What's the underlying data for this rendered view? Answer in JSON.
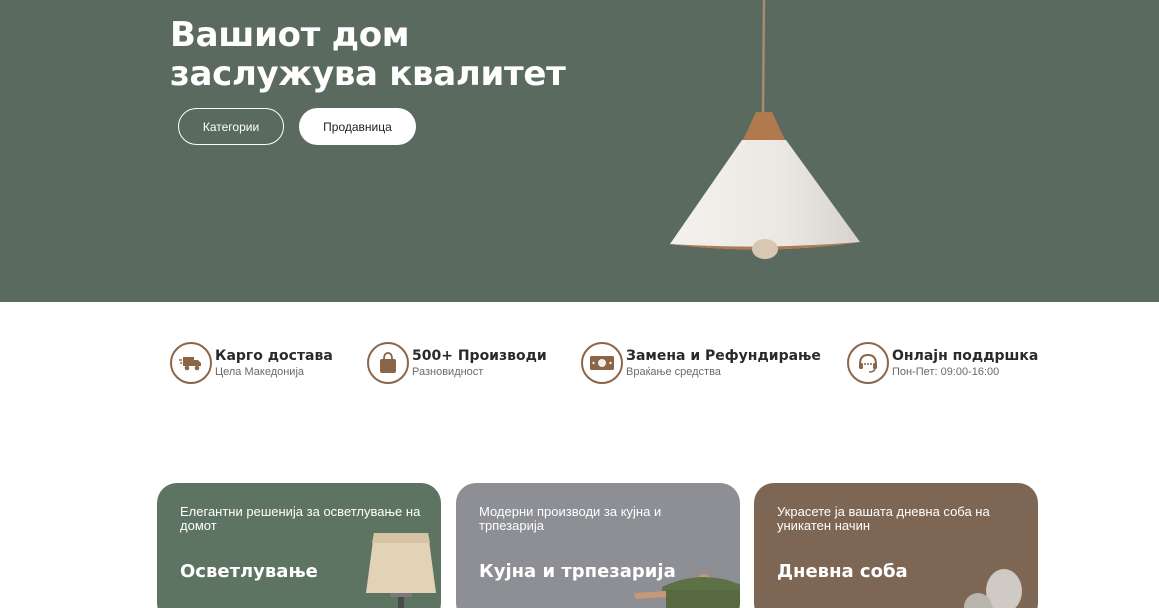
{
  "hero": {
    "title_line1": "Вашиот дом",
    "title_line2": "заслужува квалитет",
    "btn_categories": "Категории",
    "btn_shop": "Продавница"
  },
  "features": [
    {
      "title": "Карго достава",
      "subtitle": "Цела Македонија",
      "icon": "truck-icon"
    },
    {
      "title": "500+ Производи",
      "subtitle": "Разновидност",
      "icon": "shopping-bag-icon"
    },
    {
      "title": "Замена и Рефундирање",
      "subtitle": "Враќање средства",
      "icon": "money-icon"
    },
    {
      "title": "Онлајн поддршка",
      "subtitle": "Пон-Пет: 09:00-16:00",
      "icon": "headset-icon"
    }
  ],
  "categories": [
    {
      "desc": "Елегантни решенија за осветлување на домот",
      "title": "Осветлување",
      "color": "#5e7463"
    },
    {
      "desc": "Модерни производи за кујна и трпезарија",
      "title": "Кујна и трпезарија",
      "color": "#8d8f94"
    },
    {
      "desc": "Украсете ја вашата дневна соба на уникатен начин",
      "title": "Дневна соба",
      "color": "#7d6654"
    }
  ],
  "colors": {
    "hero_bg": "#5b6a5f",
    "accent": "#8b6548"
  }
}
